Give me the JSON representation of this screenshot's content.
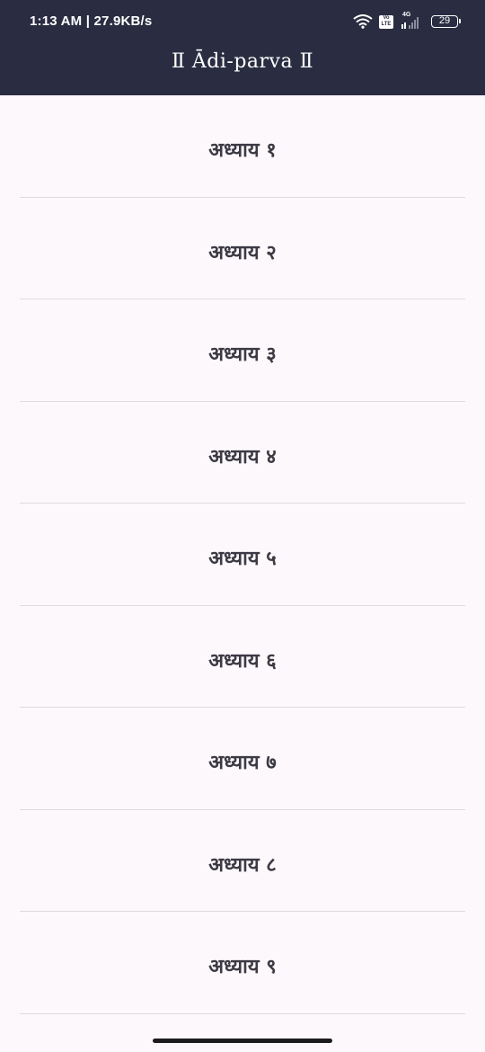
{
  "status_bar": {
    "time": "1:13 AM | 27.9KB/s",
    "volte": "Vo LTE",
    "network": "4G",
    "battery": "29"
  },
  "header": {
    "title": "Ⅱ Ādi-parva Ⅱ"
  },
  "chapters": [
    {
      "label": "अध्याय १"
    },
    {
      "label": "अध्याय २"
    },
    {
      "label": "अध्याय ३"
    },
    {
      "label": "अध्याय ४"
    },
    {
      "label": "अध्याय ५"
    },
    {
      "label": "अध्याय ६"
    },
    {
      "label": "अध्याय ७"
    },
    {
      "label": "अध्याय ८"
    },
    {
      "label": "अध्याय ९"
    }
  ],
  "colors": {
    "header_bg": "#2a2d42",
    "page_bg": "#fdf8fb",
    "divider": "#dedade",
    "row_text": "#3c3a44"
  }
}
